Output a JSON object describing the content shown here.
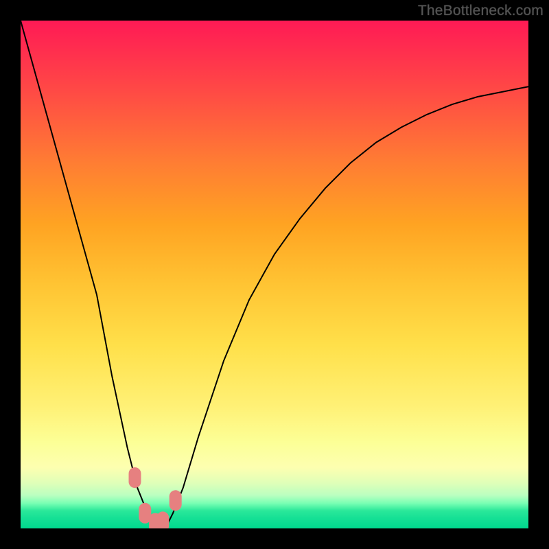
{
  "watermark": "TheBottleneck.com",
  "chart_data": {
    "type": "line",
    "title": "",
    "xlabel": "",
    "ylabel": "",
    "xlim": [
      0,
      100
    ],
    "ylim": [
      0,
      100
    ],
    "series": [
      {
        "name": "bottleneck-curve",
        "x": [
          0,
          5,
          10,
          15,
          18,
          21,
          23,
          25,
          27,
          29,
          30,
          32,
          35,
          40,
          45,
          50,
          55,
          60,
          65,
          70,
          75,
          80,
          85,
          90,
          95,
          100
        ],
        "values": [
          100,
          82,
          64,
          46,
          30,
          16,
          8,
          3,
          1,
          1,
          3,
          8,
          18,
          33,
          45,
          54,
          61,
          67,
          72,
          76,
          79,
          81.5,
          83.5,
          85,
          86,
          87
        ]
      }
    ],
    "markers": {
      "name": "sweet-spot-markers",
      "color": "#e68080",
      "x": [
        22.5,
        24.5,
        26.5,
        28.0,
        30.5
      ],
      "values": [
        10.0,
        3.0,
        1.0,
        1.3,
        5.5
      ]
    }
  },
  "colors": {
    "curve": "#000000",
    "marker_fill": "#e68080",
    "background_border": "#000000"
  }
}
